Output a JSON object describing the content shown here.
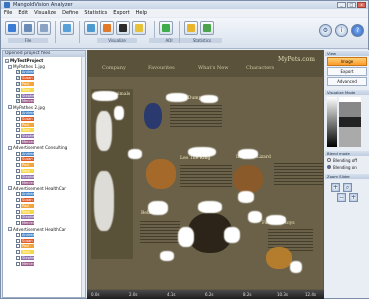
{
  "window": {
    "title": "MangoldVision Analyzer",
    "buttons": [
      "_",
      "□",
      "x"
    ]
  },
  "menu": [
    "File",
    "Edit",
    "Visualize",
    "Define",
    "Statistics",
    "Export",
    "Help"
  ],
  "toolbar": {
    "group_labels": [
      "File",
      "",
      "Visualize",
      "AOI",
      "Statistics"
    ]
  },
  "left_panel": {
    "header": "Opened project files",
    "tree": [
      {
        "level": 0,
        "text": "MyTestProject",
        "expand": "-"
      },
      {
        "level": 1,
        "text": "MyPathes 1.jpg",
        "expand": "-"
      },
      {
        "level": 2,
        "text": "Andrea",
        "checked": true,
        "color": "#4a86c8"
      },
      {
        "level": 2,
        "text": "Susan",
        "checked": true,
        "color": "#e05a2a"
      },
      {
        "level": 2,
        "text": "Paul",
        "checked": true,
        "color": "#f2a63a"
      },
      {
        "level": 2,
        "text": "Tony",
        "checked": true,
        "color": "#f6d84a"
      },
      {
        "level": 2,
        "text": "Stephen",
        "checked": true,
        "color": "#8e6fb4"
      },
      {
        "level": 2,
        "text": "Mercedi",
        "checked": true,
        "color": "#9a5a8a"
      },
      {
        "level": 1,
        "text": "MyPathes 2.jpg",
        "expand": "-"
      },
      {
        "level": 2,
        "text": "Andrea",
        "checked": false,
        "color": "#4a86c8"
      },
      {
        "level": 2,
        "text": "Susan",
        "checked": false,
        "color": "#e05a2a"
      },
      {
        "level": 2,
        "text": "Paul",
        "checked": false,
        "color": "#f2a63a"
      },
      {
        "level": 2,
        "text": "Tony",
        "checked": false,
        "color": "#f6d84a"
      },
      {
        "level": 2,
        "text": "Stephen",
        "checked": false,
        "color": "#8e6fb4"
      },
      {
        "level": 2,
        "text": "Mercedi",
        "checked": false,
        "color": "#9a5a8a"
      },
      {
        "level": 1,
        "text": "Advertisement Consulting",
        "expand": "-"
      },
      {
        "level": 2,
        "text": "Andrea",
        "checked": false,
        "color": "#4a86c8"
      },
      {
        "level": 2,
        "text": "Susan",
        "checked": false,
        "color": "#e05a2a"
      },
      {
        "level": 2,
        "text": "Paul",
        "checked": false,
        "color": "#f2a63a"
      },
      {
        "level": 2,
        "text": "Tony",
        "checked": false,
        "color": "#f6d84a"
      },
      {
        "level": 2,
        "text": "Stephen",
        "checked": false,
        "color": "#8e6fb4"
      },
      {
        "level": 2,
        "text": "Mercedi",
        "checked": false,
        "color": "#9a5a8a"
      },
      {
        "level": 1,
        "text": "Advertisement HealthCar",
        "expand": "-"
      },
      {
        "level": 2,
        "text": "Andrea",
        "checked": false,
        "color": "#4a86c8"
      },
      {
        "level": 2,
        "text": "Susan",
        "checked": false,
        "color": "#e05a2a"
      },
      {
        "level": 2,
        "text": "Paul",
        "checked": false,
        "color": "#f2a63a"
      },
      {
        "level": 2,
        "text": "Tony",
        "checked": false,
        "color": "#f6d84a"
      },
      {
        "level": 2,
        "text": "Stephen",
        "checked": false,
        "color": "#8e6fb4"
      },
      {
        "level": 2,
        "text": "Mercedi",
        "checked": false,
        "color": "#9a5a8a"
      },
      {
        "level": 1,
        "text": "Advertisement HealthCar",
        "expand": "-"
      },
      {
        "level": 2,
        "text": "Andrea",
        "checked": false,
        "color": "#4a86c8"
      },
      {
        "level": 2,
        "text": "Susan",
        "checked": false,
        "color": "#e05a2a"
      },
      {
        "level": 2,
        "text": "Paul",
        "checked": false,
        "color": "#f2a63a"
      },
      {
        "level": 2,
        "text": "Tony",
        "checked": false,
        "color": "#f6d84a"
      },
      {
        "level": 2,
        "text": "Stephen",
        "checked": false,
        "color": "#8e6fb4"
      },
      {
        "level": 2,
        "text": "Mercedi",
        "checked": false,
        "color": "#9a5a8a"
      }
    ]
  },
  "image": {
    "nav_headings": [
      "Company",
      "Favourites",
      "What's New",
      "Characters",
      "MyPets.com"
    ],
    "card_titles": [
      "Stuffed Animals",
      "Grumpy Dumpys",
      "Leo The King",
      "Inny the Lizard",
      "Bela",
      "Favourite toys"
    ]
  },
  "ruler": {
    "ticks": [
      "0.0s",
      "2.0s",
      "4.1s",
      "6.2s",
      "8.2s",
      "10.3s",
      "12.4s"
    ]
  },
  "right_panel": {
    "view_header": "View",
    "view_buttons": [
      "Image",
      "Export",
      "Advanced"
    ],
    "visualize_header": "Visualize Mode",
    "blend_header": "Blend mode",
    "blend_options": [
      "Blending off",
      "Blending on"
    ],
    "zoom_header": "Zoom Slider"
  }
}
